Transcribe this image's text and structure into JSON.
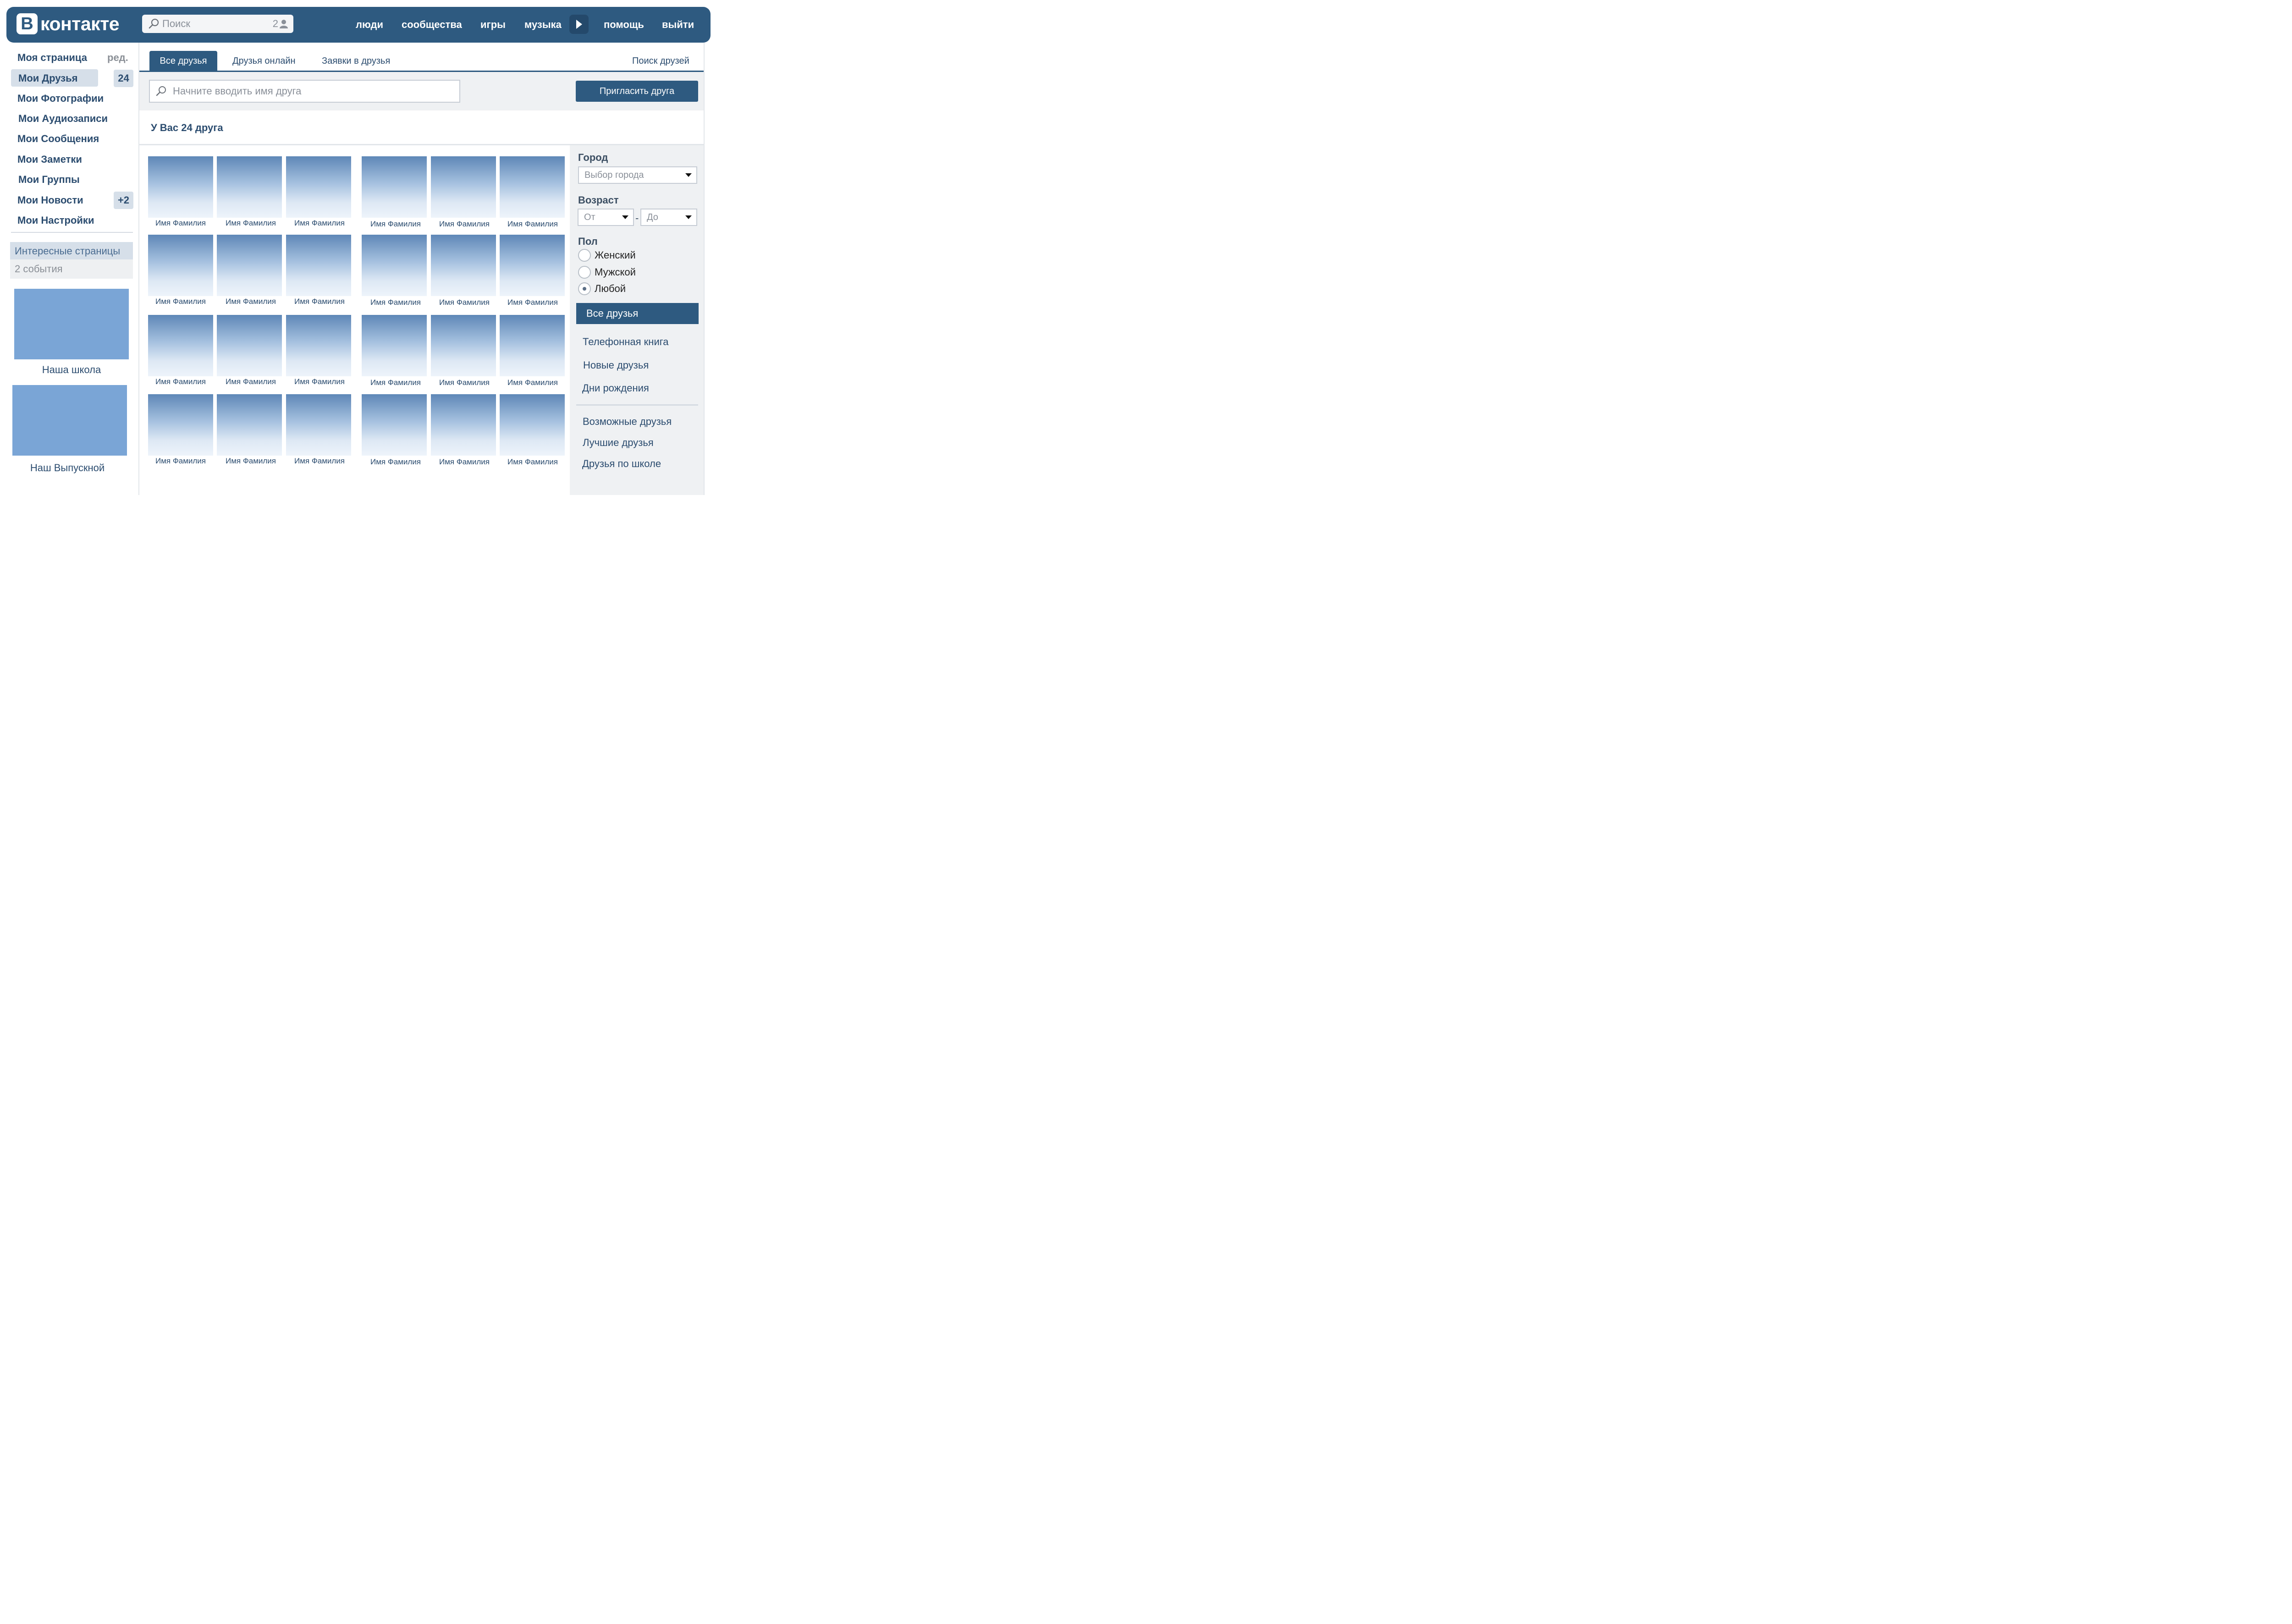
{
  "header": {
    "logo_letter": "B",
    "logo_text": "контакте",
    "search_placeholder": "Поиск",
    "search_count": "2",
    "nav": [
      "люди",
      "сообщества",
      "игры",
      "музыка",
      "помощь",
      "выйти"
    ]
  },
  "sidebar": {
    "edit_label": "ред.",
    "items": [
      {
        "label": "Моя страница"
      },
      {
        "label": "Мои Друзья",
        "badge": "24"
      },
      {
        "label": "Мои Фотографии"
      },
      {
        "label": "Мои Аудиозаписи"
      },
      {
        "label": "Мои Сообщения"
      },
      {
        "label": "Мои Заметки"
      },
      {
        "label": "Мои Группы"
      },
      {
        "label": "Мои Новости",
        "badge": "+2"
      },
      {
        "label": "Мои Настройки"
      }
    ],
    "interest_title": "Интересные страницы",
    "interest_sub": "2 события",
    "pages": [
      {
        "caption": "Наша школа"
      },
      {
        "caption": "Наш Выпускной"
      }
    ]
  },
  "tabs": {
    "items": [
      "Все друзья",
      "Друзья онлайн",
      "Заявки в друзья"
    ],
    "search_friends": "Поиск друзей"
  },
  "toolbar": {
    "search_placeholder": "Начните вводить имя друга",
    "invite_label": "Пригласить друга"
  },
  "main": {
    "count_title": "У Вас 24 друга",
    "friends": [
      "Имя Фамилия",
      "Имя Фамилия",
      "Имя Фамилия",
      "Имя Фамилия",
      "Имя Фамилия",
      "Имя Фамилия",
      "Имя Фамилия",
      "Имя Фамилия",
      "Имя Фамилия",
      "Имя Фамилия",
      "Имя Фамилия",
      "Имя Фамилия",
      "Имя Фамилия",
      "Имя Фамилия",
      "Имя Фамилия",
      "Имя Фамилия",
      "Имя Фамилия",
      "Имя Фамилия",
      "Имя Фамилия",
      "Имя Фамилия",
      "Имя Фамилия",
      "Имя Фамилия",
      "Имя Фамилия",
      "Имя Фамилия"
    ]
  },
  "filters": {
    "city_label": "Город",
    "city_placeholder": "Выбор города",
    "age_label": "Возраст",
    "age_from": "От",
    "age_dash": "-",
    "age_to": "До",
    "gender_label": "Пол",
    "genders": [
      "Женский",
      "Мужской",
      "Любой"
    ],
    "selected_gender": "Любой",
    "active_list": "Все друзья",
    "links": [
      "Телефонная книга",
      "Новые друзья",
      "Дни рождения"
    ],
    "links2": [
      "Возможные друзья",
      "Лучшие друзья",
      "Друзья по школе"
    ]
  },
  "colors": {
    "brand": "#2e5a80",
    "accent_light": "#d6dfe9",
    "page_image": "#7aa5d6"
  }
}
